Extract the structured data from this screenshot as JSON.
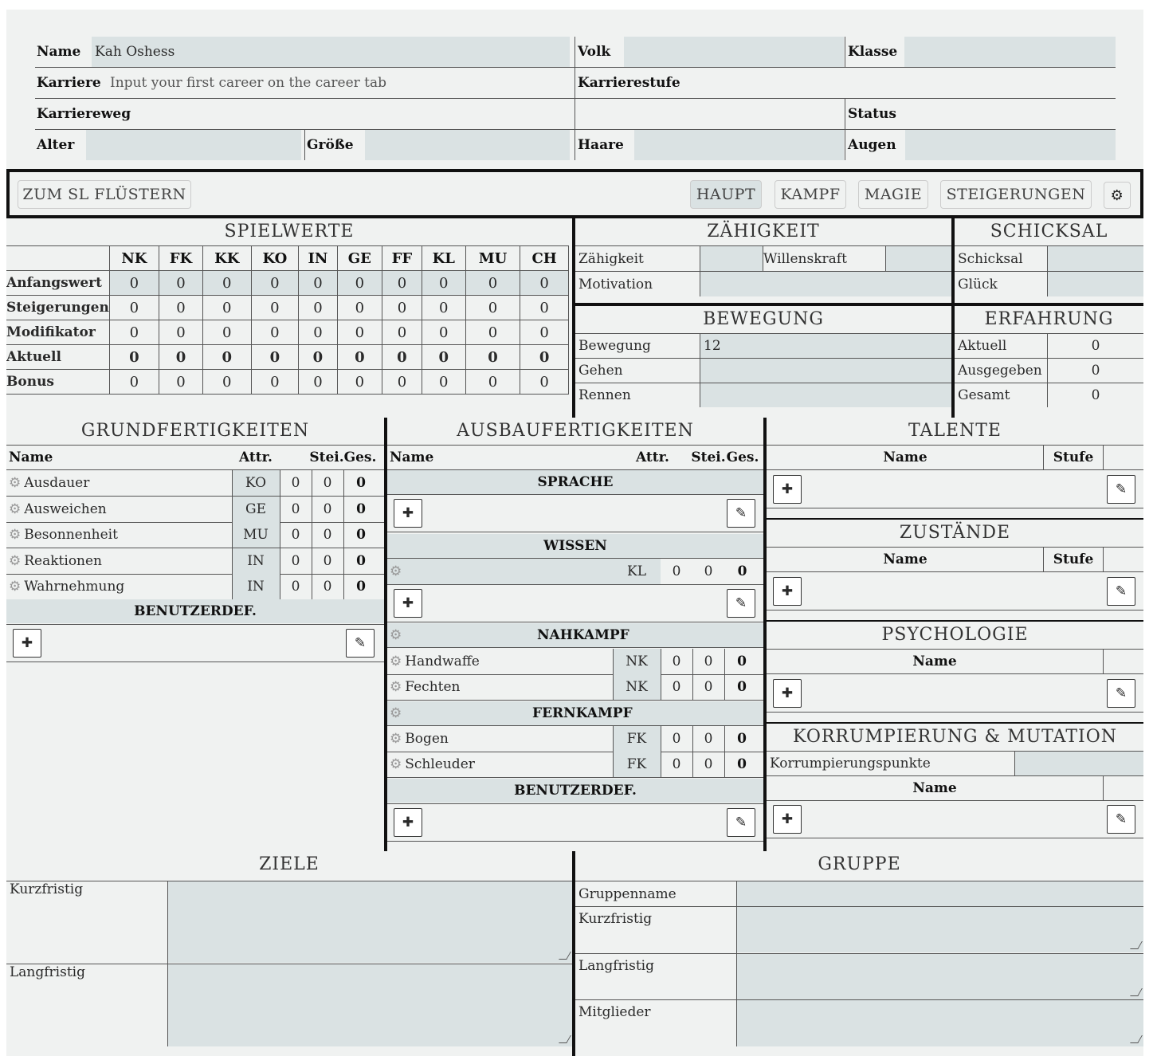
{
  "header": {
    "name_label": "Name",
    "name_value": "Kah Oshess",
    "volk_label": "Volk",
    "klasse_label": "Klasse",
    "karriere_label": "Karriere",
    "karriere_placeholder": "Input your first career on the career tab",
    "karrierestufe_label": "Karrierestufe",
    "karriereweg_label": "Karriereweg",
    "status_label": "Status",
    "alter_label": "Alter",
    "groesse_label": "Größe",
    "haare_label": "Haare",
    "augen_label": "Augen"
  },
  "toolbar": {
    "whisper": "ZUM SL FLÜSTERN",
    "tabs": [
      "HAUPT",
      "KAMPF",
      "MAGIE",
      "STEIGERUNGEN"
    ],
    "active_tab": "HAUPT"
  },
  "spielwerte": {
    "title": "SPIELWERTE",
    "columns": [
      "NK",
      "FK",
      "KK",
      "KO",
      "IN",
      "GE",
      "FF",
      "KL",
      "MU",
      "CH"
    ],
    "rows": [
      {
        "label": "Anfangswert",
        "values": [
          "0",
          "0",
          "0",
          "0",
          "0",
          "0",
          "0",
          "0",
          "0",
          "0"
        ]
      },
      {
        "label": "Steigerungen",
        "values": [
          "0",
          "0",
          "0",
          "0",
          "0",
          "0",
          "0",
          "0",
          "0",
          "0"
        ]
      },
      {
        "label": "Modifikator",
        "values": [
          "0",
          "0",
          "0",
          "0",
          "0",
          "0",
          "0",
          "0",
          "0",
          "0"
        ]
      },
      {
        "label": "Aktuell",
        "values": [
          "0",
          "0",
          "0",
          "0",
          "0",
          "0",
          "0",
          "0",
          "0",
          "0"
        ]
      },
      {
        "label": "Bonus",
        "values": [
          "0",
          "0",
          "0",
          "0",
          "0",
          "0",
          "0",
          "0",
          "0",
          "0"
        ]
      }
    ]
  },
  "zaehigkeit": {
    "title": "ZÄHIGKEIT",
    "zaehigkeit": "Zähigkeit",
    "willenskraft": "Willenskraft",
    "motivation": "Motivation"
  },
  "schicksal": {
    "title": "SCHICKSAL",
    "schicksal": "Schicksal",
    "glueck": "Glück"
  },
  "bewegung": {
    "title": "BEWEGUNG",
    "bewegung": "Bewegung",
    "bewegung_value": "12",
    "gehen": "Gehen",
    "rennen": "Rennen"
  },
  "erfahrung": {
    "title": "ERFAHRUNG",
    "aktuell": "Aktuell",
    "aktuell_value": "0",
    "ausgegeben": "Ausgegeben",
    "ausgegeben_value": "0",
    "gesamt": "Gesamt",
    "gesamt_value": "0"
  },
  "grund": {
    "title": "GRUNDFERTIGKEITEN",
    "h_name": "Name",
    "h_attr": "Attr.",
    "h_stei": "Stei.",
    "h_ges": "Ges.",
    "skills": [
      {
        "name": "Ausdauer",
        "attr": "KO",
        "stei": "0",
        "v": "0",
        "ges": "0"
      },
      {
        "name": "Ausweichen",
        "attr": "GE",
        "stei": "0",
        "v": "0",
        "ges": "0"
      },
      {
        "name": "Besonnenheit",
        "attr": "MU",
        "stei": "0",
        "v": "0",
        "ges": "0"
      },
      {
        "name": "Reaktionen",
        "attr": "IN",
        "stei": "0",
        "v": "0",
        "ges": "0"
      },
      {
        "name": "Wahrnehmung",
        "attr": "IN",
        "stei": "0",
        "v": "0",
        "ges": "0"
      }
    ],
    "custom": "BENUTZERDEF."
  },
  "ausbau": {
    "title": "AUSBAUFERTIGKEITEN",
    "h_name": "Name",
    "h_attr": "Attr.",
    "h_stei": "Stei.",
    "h_ges": "Ges.",
    "sprache": "SPRACHE",
    "wissen": "WISSEN",
    "wissen_attr": "KL",
    "nahkampf": "NAHKAMPF",
    "fernkampf": "FERNKAMPF",
    "zero": "0",
    "nah": [
      {
        "name": "Handwaffe",
        "attr": "NK"
      },
      {
        "name": "Fechten",
        "attr": "NK"
      }
    ],
    "fern": [
      {
        "name": "Bogen",
        "attr": "FK"
      },
      {
        "name": "Schleuder",
        "attr": "FK"
      }
    ],
    "custom": "BENUTZERDEF."
  },
  "talente": {
    "title": "TALENTE",
    "name": "Name",
    "stufe": "Stufe"
  },
  "zustaende": {
    "title": "ZUSTÄNDE",
    "name": "Name",
    "stufe": "Stufe"
  },
  "psychologie": {
    "title": "PSYCHOLOGIE",
    "name": "Name"
  },
  "korrumpierung": {
    "title": "KORRUMPIERUNG & MUTATION",
    "punkte": "Korrumpierungspunkte",
    "name": "Name"
  },
  "ziele": {
    "title": "ZIELE",
    "kurz": "Kurzfristig",
    "lang": "Langfristig"
  },
  "gruppe": {
    "title": "GRUPPE",
    "name": "Gruppenname",
    "kurz": "Kurzfristig",
    "lang": "Langfristig",
    "mitglieder": "Mitglieder"
  }
}
